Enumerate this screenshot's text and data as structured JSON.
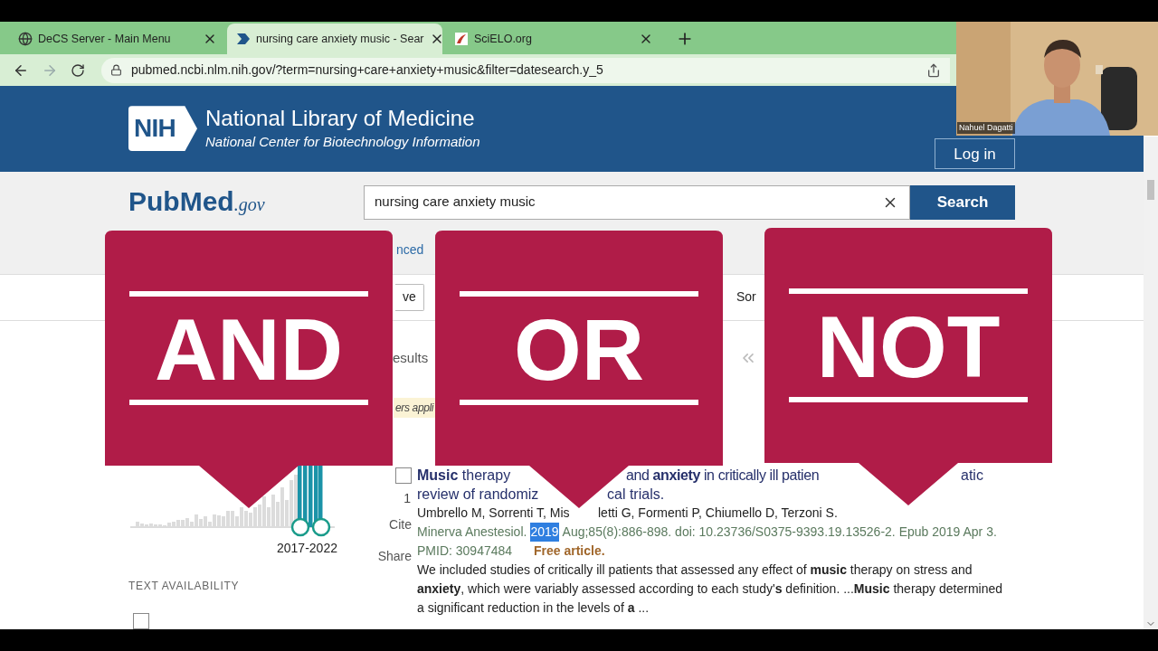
{
  "browser": {
    "tabs": [
      {
        "kind": "globe",
        "title": "DeCS Server - Main Menu",
        "selected": false
      },
      {
        "kind": "pubmed",
        "title": "nursing care anxiety music - Sear",
        "selected": true
      },
      {
        "kind": "scielo",
        "title": "SciELO.org",
        "selected": false
      }
    ],
    "url": "pubmed.ncbi.nlm.nih.gov/?term=nursing+care+anxiety+music&filter=datesearch.y_5"
  },
  "header": {
    "logo": "NIH",
    "title": "National Library of Medicine",
    "subtitle": "National Center for Biotechnology Information",
    "login": "Log in"
  },
  "search": {
    "logo_name": "PubMed",
    "logo_domain": ".gov",
    "query": "nursing care anxiety music",
    "button": "Search",
    "link_fragment": "nced"
  },
  "toolbar": {
    "save_fragment": "ve",
    "sort_fragment": "Sor"
  },
  "results": {
    "count_fragment": "esults",
    "filters_fragment": "ers appli"
  },
  "timeline": {
    "range": "2017-2022"
  },
  "sidebar": {
    "section": "TEXT AVAILABILITY",
    "checked": false
  },
  "article": {
    "checked": false,
    "number": "1",
    "actions": [
      "Cite",
      "Share"
    ],
    "title_line1": [
      "**Music** therapy",
      "and **anxiety** in critically ill patien",
      "atic"
    ],
    "title_line2": [
      "review of randomiz",
      "cal trials."
    ],
    "authors": [
      "Umbrello M, Sorrenti T, Mis",
      "letti G, Formenti P, Chiumello D, Terzoni S."
    ],
    "journal": "Minerva Anestesiol.",
    "year": "2019",
    "year_highlighted": true,
    "citation": "Aug;85(8):886-898. doi: 10.23736/S0375-9393.19.13526-2. Epub 2019 Apr 3.",
    "pmid": "PMID: 30947484",
    "free": "Free article.",
    "snippet": [
      "We included studies of critically ill patients that assessed any effect of **music** therapy on stress and",
      "**anxiety**, which were variably assessed according to each study'**s** definition. ...**Music** therapy determined",
      "a significant reduction in the levels of **a** ..."
    ]
  },
  "overlays": [
    {
      "word": "AND"
    },
    {
      "word": "OR"
    },
    {
      "word": "NOT"
    }
  ],
  "webcam": {
    "name": "Nahuel Dagatti"
  }
}
